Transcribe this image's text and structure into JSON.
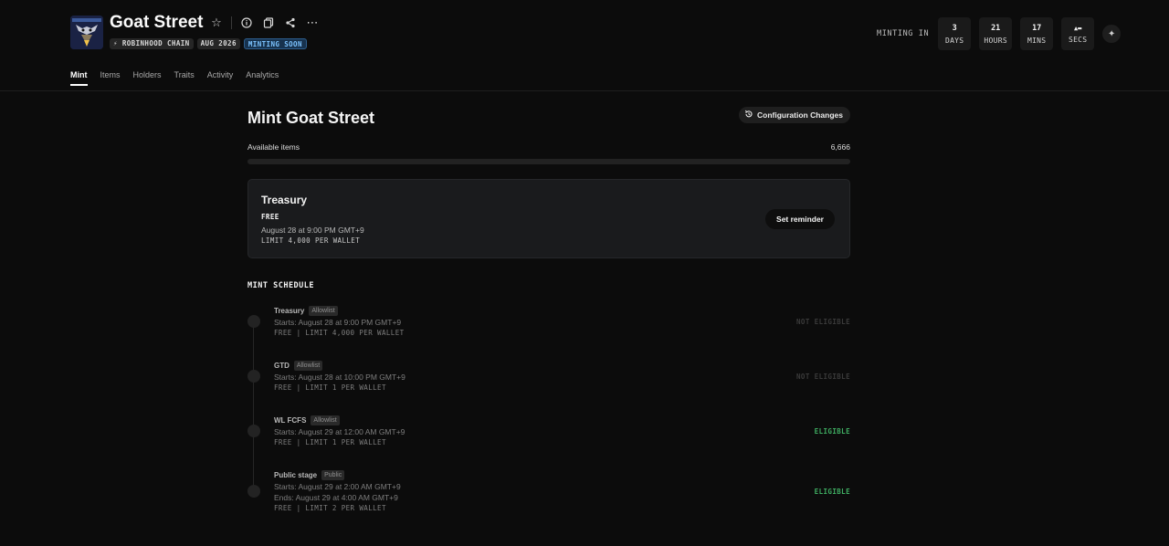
{
  "collection": {
    "title": "Goat Street",
    "badges": {
      "chain": "⚡ ROBINHOOD CHAIN",
      "date": "AUG 2026",
      "status": "MINTING SOON"
    }
  },
  "countdown": {
    "label": "MINTING IN",
    "units": [
      {
        "value": "3",
        "label": "DAYS"
      },
      {
        "value": "21",
        "label": "HOURS"
      },
      {
        "value": "17",
        "label": "MINS"
      },
      {
        "value": "▲▬",
        "label": "SECS"
      }
    ]
  },
  "tabs": [
    "Mint",
    "Items",
    "Holders",
    "Traits",
    "Activity",
    "Analytics"
  ],
  "main": {
    "title": "Mint Goat Street",
    "config_label": "Configuration Changes",
    "available_label": "Available items",
    "available_value": "6,666",
    "available_progress": 0
  },
  "card": {
    "title": "Treasury",
    "price": "FREE",
    "date": "August 28 at 9:00 PM GMT+9",
    "limit": "LIMIT 4,000 PER WALLET",
    "button": "Set reminder"
  },
  "schedule": {
    "title": "MINT SCHEDULE",
    "stages": [
      {
        "name": "Treasury",
        "tag": "Allowlist",
        "starts": "Starts: August 28 at 9:00 PM GMT+9",
        "ends": "",
        "meta": "FREE | LIMIT 4,000 PER WALLET",
        "status": "NOT ELIGIBLE"
      },
      {
        "name": "GTD",
        "tag": "Allowlist",
        "starts": "Starts: August 28 at 10:00 PM GMT+9",
        "ends": "",
        "meta": "FREE | LIMIT 1 PER WALLET",
        "status": "NOT ELIGIBLE"
      },
      {
        "name": "WL FCFS",
        "tag": "Allowlist",
        "starts": "Starts: August 29 at 12:00 AM GMT+9",
        "ends": "",
        "meta": "FREE | LIMIT 1 PER WALLET",
        "status": "ELIGIBLE"
      },
      {
        "name": "Public stage",
        "tag": "Public",
        "starts": "Starts: August 29 at 2:00 AM GMT+9",
        "ends": "Ends: August 29 at 4:00 AM GMT+9",
        "meta": "FREE | LIMIT 2 PER WALLET",
        "status": "ELIGIBLE"
      }
    ]
  },
  "colors": {
    "background": "#0c0c0c",
    "eligible": "#3fae62",
    "not_eligible": "#3a3a3a",
    "soon_badge": "#7cc3ff"
  }
}
